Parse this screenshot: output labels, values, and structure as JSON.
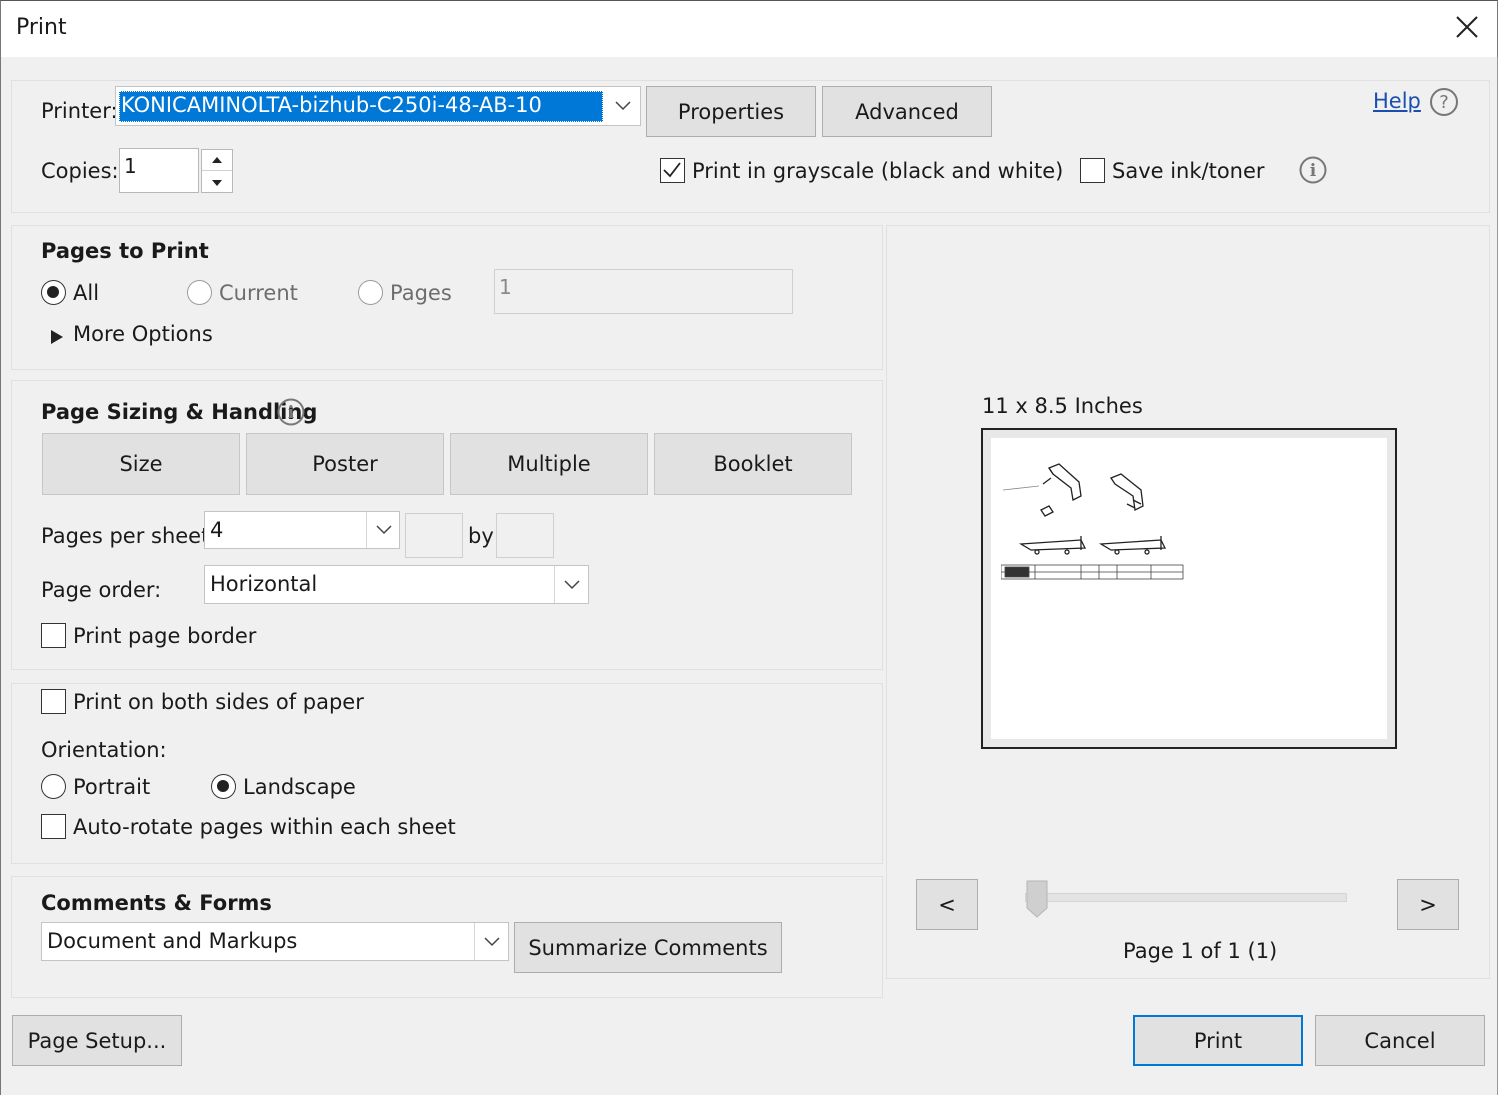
{
  "window": {
    "title": "Print"
  },
  "printer": {
    "label": "Printer:",
    "selected": "KONICAMINOLTA-bizhub-C250i-48-AB-10",
    "properties_label": "Properties",
    "advanced_label": "Advanced",
    "help_label": "Help"
  },
  "copies": {
    "label": "Copies:",
    "value": "1"
  },
  "options": {
    "grayscale_label": "Print in grayscale (black and white)",
    "grayscale_checked": true,
    "save_ink_label": "Save ink/toner",
    "save_ink_checked": false
  },
  "pages_to_print": {
    "heading": "Pages to Print",
    "all_label": "All",
    "current_label": "Current",
    "pages_label": "Pages",
    "pages_value": "1",
    "selected": "All",
    "more_options_label": "More Options"
  },
  "sizing": {
    "heading": "Page Sizing & Handling",
    "tabs": [
      "Size",
      "Poster",
      "Multiple",
      "Booklet"
    ],
    "pages_per_sheet_label": "Pages per sheet:",
    "pages_per_sheet_value": "4",
    "by_label": "by",
    "page_order_label": "Page order:",
    "page_order_value": "Horizontal",
    "print_border_label": "Print page border",
    "print_border_checked": false
  },
  "layout": {
    "both_sides_label": "Print on both sides of paper",
    "both_sides_checked": false,
    "orientation_label": "Orientation:",
    "portrait_label": "Portrait",
    "landscape_label": "Landscape",
    "selected_orientation": "Landscape",
    "auto_rotate_label": "Auto-rotate pages within each sheet",
    "auto_rotate_checked": false
  },
  "comments_forms": {
    "heading": "Comments & Forms",
    "selected": "Document and Markups",
    "summarize_label": "Summarize Comments"
  },
  "preview": {
    "size_label": "11 x 8.5 Inches",
    "prev_label": "<",
    "next_label": ">",
    "page_status": "Page 1 of 1 (1)",
    "slider_position": 0
  },
  "footer": {
    "page_setup_label": "Page Setup...",
    "print_label": "Print",
    "cancel_label": "Cancel"
  },
  "colors": {
    "accent": "#0078d7",
    "link": "#1a4fb0",
    "selection": "#0078d7"
  }
}
